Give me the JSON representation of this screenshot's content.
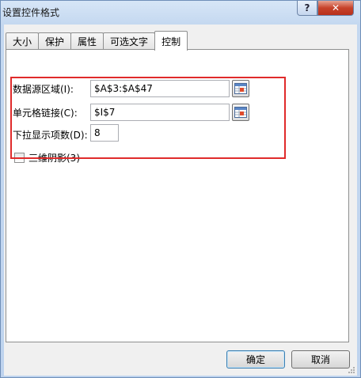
{
  "window": {
    "title": "设置控件格式",
    "help_label": "?",
    "close_label": "✕"
  },
  "tabs": [
    {
      "label": "大小",
      "active": false
    },
    {
      "label": "保护",
      "active": false
    },
    {
      "label": "属性",
      "active": false
    },
    {
      "label": "可选文字",
      "active": false
    },
    {
      "label": "控制",
      "active": true
    }
  ],
  "control": {
    "input_range": {
      "label": "数据源区域(I):",
      "value": "$A$3:$A$47"
    },
    "cell_link": {
      "label": "单元格链接(C):",
      "value": "$I$7"
    },
    "drop_down_lines": {
      "label": "下拉显示项数(D):",
      "value": "8"
    },
    "shading_3d": {
      "label": "三维阴影(3)",
      "checked": false
    }
  },
  "footer": {
    "ok_label": "确定",
    "cancel_label": "取消"
  },
  "colors": {
    "highlight": "#e02b2b",
    "panel": "#ffffff",
    "dialog_bg": "#f0f0f0"
  },
  "icons": [
    "range-select-icon",
    "checkbox-icon",
    "close-icon",
    "help-icon"
  ]
}
